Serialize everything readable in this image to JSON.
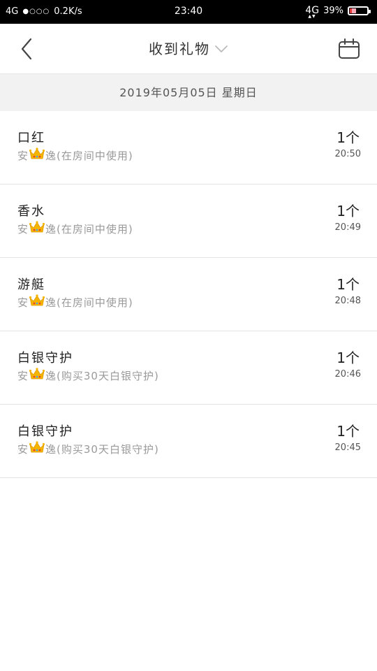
{
  "status_bar": {
    "network_left": "4G",
    "signal_dots": "●○○○",
    "speed": "0.2K/s",
    "time": "23:40",
    "network_right": "4G",
    "battery_percent": "39%",
    "battery_level": 0.39
  },
  "header": {
    "title": "收到礼物",
    "back_icon": "back-arrow-icon",
    "calendar_icon": "calendar-icon"
  },
  "date_label": "2019年05月05日 星期日",
  "gifts": [
    {
      "name": "口红",
      "sender_prefix": "安",
      "sender_suffix": "逸",
      "note": "(在房间中使用)",
      "quantity": "1个",
      "time": "20:50"
    },
    {
      "name": "香水",
      "sender_prefix": "安",
      "sender_suffix": "逸",
      "note": "(在房间中使用)",
      "quantity": "1个",
      "time": "20:49"
    },
    {
      "name": "游艇",
      "sender_prefix": "安",
      "sender_suffix": "逸",
      "note": "(在房间中使用)",
      "quantity": "1个",
      "time": "20:48"
    },
    {
      "name": "白银守护",
      "sender_prefix": "安",
      "sender_suffix": "逸",
      "note": "(购买30天白银守护)",
      "quantity": "1个",
      "time": "20:46"
    },
    {
      "name": "白银守护",
      "sender_prefix": "安",
      "sender_suffix": "逸",
      "note": "(购买30天白银守护)",
      "quantity": "1个",
      "time": "20:45"
    }
  ]
}
